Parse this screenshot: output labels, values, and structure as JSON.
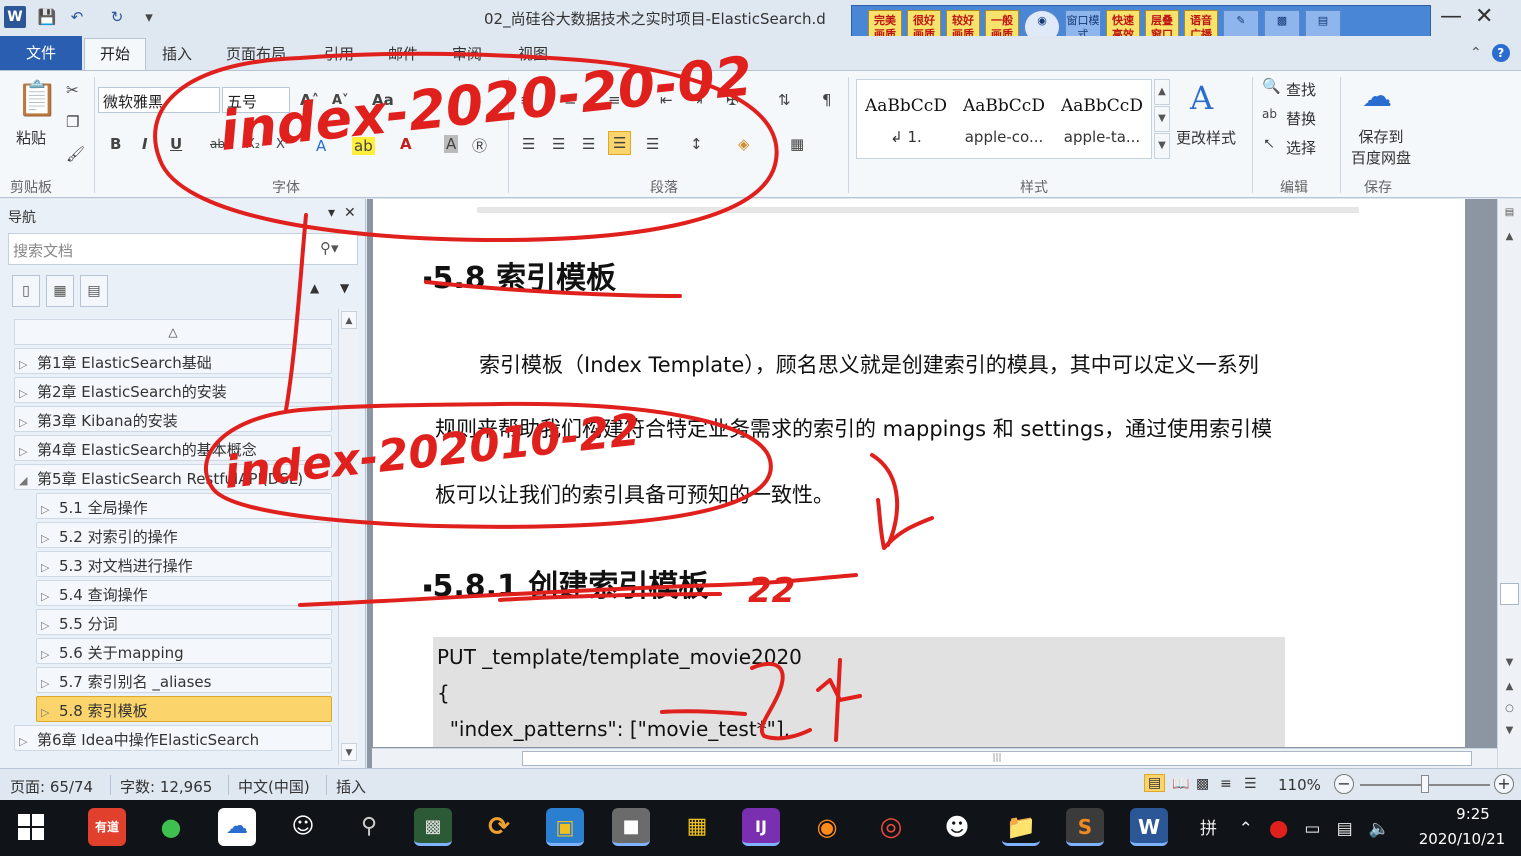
{
  "title_bar": {
    "document_title": "02_尚硅谷大数据技术之实时项目-ElasticSearch.d",
    "quick_access": [
      "save-icon",
      "undo-icon",
      "redo-icon",
      "customize-icon"
    ]
  },
  "ext_toolbar": {
    "buttons": [
      "完美画质",
      "很好画质",
      "较好画质",
      "一般画质"
    ],
    "tools": [
      "窗口模式",
      "快速高效",
      "层叠窗口",
      "语音广播"
    ]
  },
  "ribbon_tabs": [
    "文件",
    "开始",
    "插入",
    "页面布局",
    "引用",
    "邮件",
    "审阅",
    "视图"
  ],
  "ribbon": {
    "paste_label": "粘贴",
    "clipboard_group": "剪贴板",
    "font_name": "微软雅黑",
    "font_size": "五号",
    "font_group": "字体",
    "paragraph_group": "段落",
    "styles": [
      {
        "sample": "AaBbCcD",
        "name": "↲ 1."
      },
      {
        "sample": "AaBbCcD",
        "name": "apple-co..."
      },
      {
        "sample": "AaBbCcD",
        "name": "apple-ta..."
      }
    ],
    "change_styles": "更改样式",
    "styles_group": "样式",
    "find": "查找",
    "replace": "替换",
    "select": "选择",
    "editing_group": "编辑",
    "save_to_cloud_line1": "保存到",
    "save_to_cloud_line2": "百度网盘",
    "save_group": "保存"
  },
  "nav": {
    "title": "导航",
    "search_placeholder": "搜索文档",
    "items": [
      {
        "label": "第1章 ElasticSearch基础",
        "level": 1
      },
      {
        "label": "第2章 ElasticSearch的安装",
        "level": 1
      },
      {
        "label": "第3章 Kibana的安装",
        "level": 1
      },
      {
        "label": "第4章 ElasticSearch的基本概念",
        "level": 1
      },
      {
        "label": "第5章 ElasticSearch RestfulAPI(DSL)",
        "level": 1,
        "expanded": true
      },
      {
        "label": "5.1 全局操作",
        "level": 2
      },
      {
        "label": "5.2 对索引的操作",
        "level": 2
      },
      {
        "label": "5.3 对文档进行操作",
        "level": 2
      },
      {
        "label": "5.4 查询操作",
        "level": 2
      },
      {
        "label": "5.5 分词",
        "level": 2
      },
      {
        "label": "5.6 关于mapping",
        "level": 2
      },
      {
        "label": "5.7 索引别名 _aliases",
        "level": 2
      },
      {
        "label": "5.8 索引模板",
        "level": 2,
        "active": true
      },
      {
        "label": "第6章 Idea中操作ElasticSearch",
        "level": 1
      }
    ]
  },
  "document": {
    "heading_1": "5.8  索引模板",
    "para_line1": "索引模板（Index  Template），顾名思义就是创建索引的模具，其中可以定义一系列",
    "para_line2": "规则来帮助我们构建符合特定业务需求的索引的 mappings 和 settings，通过使用索引模",
    "para_line3": "板可以让我们的索引具备可预知的一致性。",
    "heading_2": "5.8.1 创建索引模板",
    "code": [
      "PUT _template/template_movie2020",
      "{",
      "  \"index_patterns\": [\"movie_test*\"],"
    ]
  },
  "annotations": {
    "ink_color": "#e0201c",
    "ink_text_1": "index-2020-20-02",
    "ink_text_2": "index-202010-22",
    "ink_text_3": "22",
    "ink_text_4": "24"
  },
  "status": {
    "page": "页面: 65/74",
    "words": "字数: 12,965",
    "language": "中文(中国)",
    "mode": "插入",
    "zoom": "110%",
    "zoom_level_fraction": 0.47
  },
  "taskbar": {
    "apps": [
      "有道",
      "微信",
      "百度网盘",
      "用户",
      "放大镜",
      "终端",
      "同步",
      "远程",
      "应用",
      "IntelliJ IDEA",
      "Firefox",
      "Chrome",
      "QQ",
      "文件资源管理器",
      "Sublime",
      "Word"
    ],
    "ime": "拼",
    "time": "9:25",
    "date": "2020/10/21"
  }
}
